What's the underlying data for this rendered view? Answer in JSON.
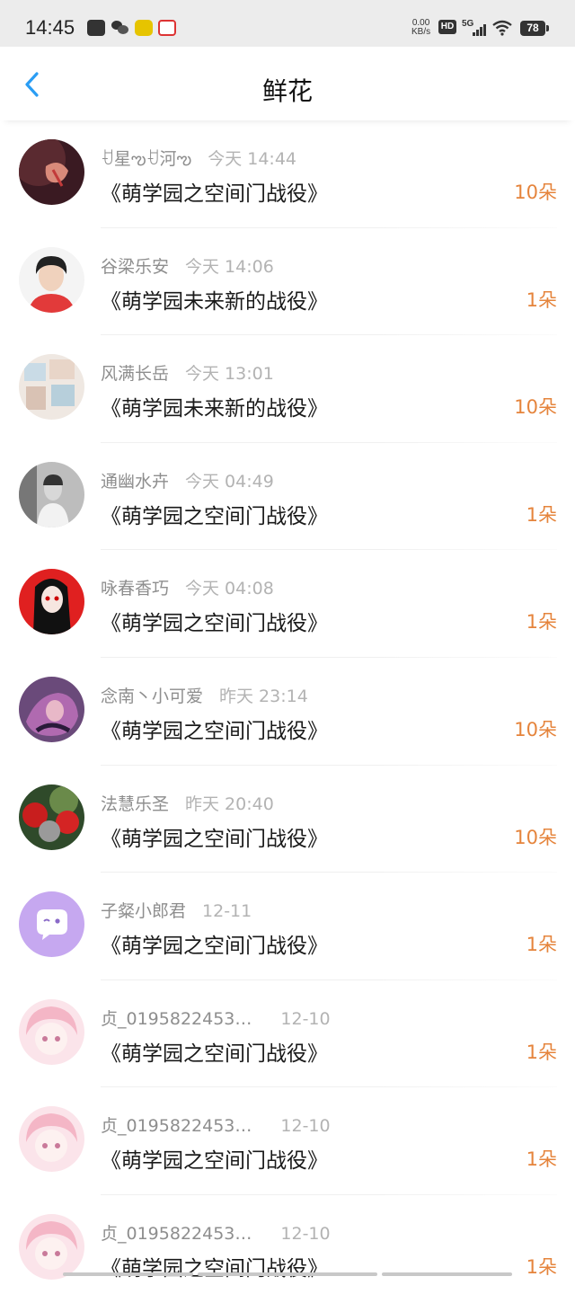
{
  "status_bar": {
    "time": "14:45",
    "net_speed_value": "0.00",
    "net_speed_unit": "KB/s",
    "hd": "HD",
    "network": "5G",
    "battery": "78",
    "icons": [
      "mail-icon",
      "wechat-icon",
      "app-notification-icon",
      "app-notification-icon",
      "signal-icon",
      "wifi-icon",
      "battery-icon"
    ]
  },
  "nav": {
    "back_icon": "chevron-left-icon",
    "title": "鲜花",
    "accent_color": "#2a9df4"
  },
  "colors": {
    "flower_count": "#e5843c",
    "username": "#8e8e8e",
    "time": "#b3b3b3"
  },
  "items": [
    {
      "user": "ꀀ星ఌ︎ꀀ河ఌ︎",
      "time": "今天 14:44",
      "book": "《萌学园之空间门战役》",
      "flowers": "10朵"
    },
    {
      "user": "谷梁乐安",
      "time": "今天 14:06",
      "book": "《萌学园未来新的战役》",
      "flowers": "1朵"
    },
    {
      "user": "风满长岳",
      "time": "今天 13:01",
      "book": "《萌学园未来新的战役》",
      "flowers": "10朵"
    },
    {
      "user": "通幽水卉",
      "time": "今天 04:49",
      "book": "《萌学园之空间门战役》",
      "flowers": "1朵"
    },
    {
      "user": "咏春香巧",
      "time": "今天 04:08",
      "book": "《萌学园之空间门战役》",
      "flowers": "1朵"
    },
    {
      "user": "念南丶小可爱",
      "time": "昨天 23:14",
      "book": "《萌学园之空间门战役》",
      "flowers": "10朵"
    },
    {
      "user": "法慧乐圣",
      "time": "昨天 20:40",
      "book": "《萌学园之空间门战役》",
      "flowers": "10朵"
    },
    {
      "user": "子粲小郎君",
      "time": "12-11",
      "book": "《萌学园之空间门战役》",
      "flowers": "1朵"
    },
    {
      "user": "贞_0195822453…",
      "time": "12-10",
      "book": "《萌学园之空间门战役》",
      "flowers": "1朵"
    },
    {
      "user": "贞_0195822453…",
      "time": "12-10",
      "book": "《萌学园之空间门战役》",
      "flowers": "1朵"
    },
    {
      "user": "贞_0195822453…",
      "time": "12-10",
      "book": "《萌学园之空间门战役》",
      "flowers": "1朵"
    }
  ]
}
